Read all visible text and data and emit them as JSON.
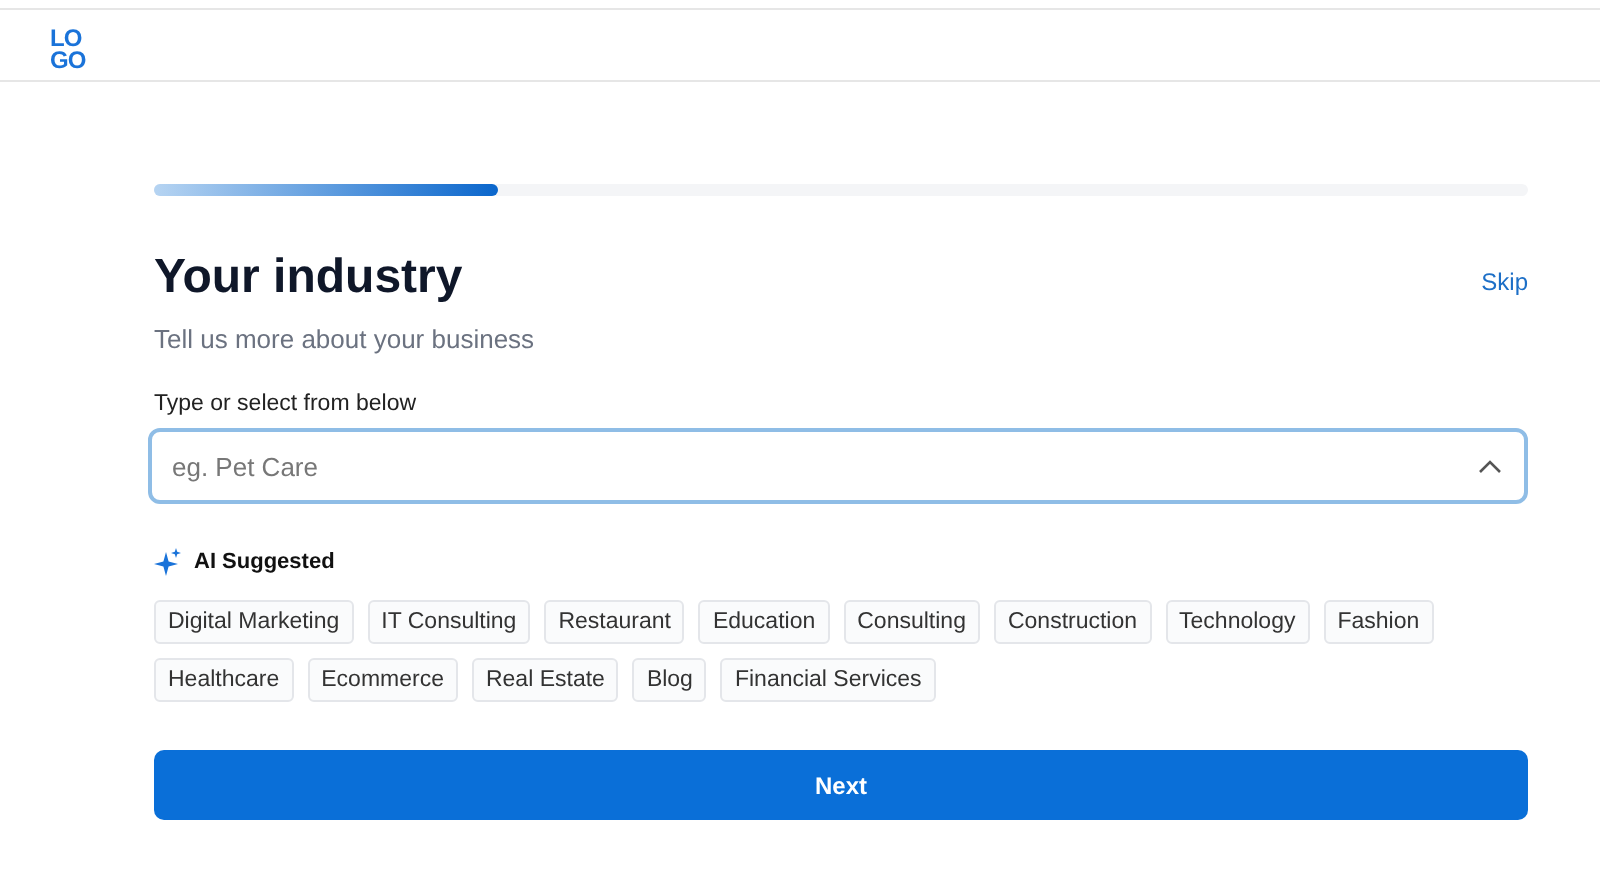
{
  "logo": {
    "lines": [
      "LO",
      "GO"
    ]
  },
  "progress": {
    "level": 0.25
  },
  "title": "Your industry",
  "skip": "Skip",
  "subtitle": "Tell us more about your business",
  "field": {
    "label": "Type or select from below",
    "placeholder": "eg. Pet Care",
    "expanded": true
  },
  "suggestions": {
    "heading": "AI Suggested",
    "chips": [
      {
        "label": "Digital Marketing"
      },
      {
        "label": "IT Consulting"
      },
      {
        "label": "Restaurant"
      },
      {
        "label": "Education"
      },
      {
        "label": "Consulting"
      },
      {
        "label": "Construction"
      },
      {
        "label": "Technology"
      },
      {
        "label": "Fashion"
      },
      {
        "label": "Healthcare"
      },
      {
        "label": "Ecommerce"
      },
      {
        "label": "Real Estate"
      },
      {
        "label": "Blog"
      },
      {
        "label": "Financial Services"
      }
    ]
  },
  "next_button": "Next"
}
